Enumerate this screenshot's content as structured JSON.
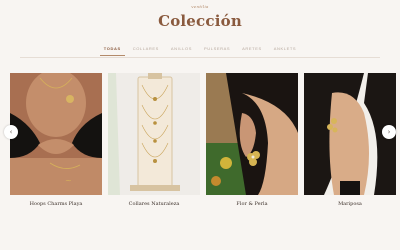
{
  "header": {
    "brand": "ventilia",
    "title": "Colección"
  },
  "tabs": [
    {
      "label": "TODAS",
      "active": true
    },
    {
      "label": "COLLARES",
      "active": false
    },
    {
      "label": "ANILLOS",
      "active": false
    },
    {
      "label": "PULSERAS",
      "active": false
    },
    {
      "label": "ARETES",
      "active": false
    },
    {
      "label": "ANKLETS",
      "active": false
    }
  ],
  "products": [
    {
      "name": "Hoops Charms Playa",
      "icon": "bikini-necklace-photo"
    },
    {
      "name": "Collares Naturaleza",
      "icon": "necklace-display-photo"
    },
    {
      "name": "Flor & Perla",
      "icon": "flower-earring-photo"
    },
    {
      "name": "Mariposa",
      "icon": "butterfly-earring-photo"
    }
  ],
  "carousel": {
    "prev_icon": "‹",
    "next_icon": "›"
  },
  "colors": {
    "accent": "#8a5a3e",
    "background": "#f8f5f2",
    "tab_inactive": "#b7a99e"
  }
}
